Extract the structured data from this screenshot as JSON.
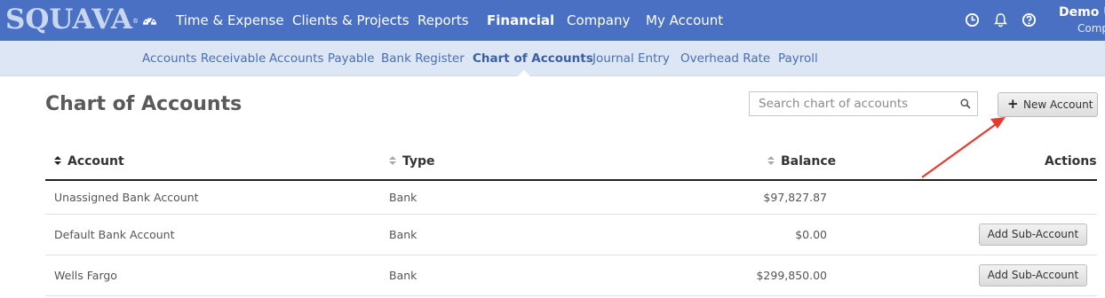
{
  "app": {
    "logo_text": "SQUAVA",
    "logo_mark": "®"
  },
  "nav": {
    "items": [
      {
        "label": "Time & Expense"
      },
      {
        "label": "Clients & Projects"
      },
      {
        "label": "Reports"
      },
      {
        "label": "Financial"
      },
      {
        "label": "Company"
      },
      {
        "label": "My Account"
      }
    ],
    "active": "Financial",
    "icons": [
      "dashboard-icon",
      "clock-icon",
      "bell-icon",
      "help-icon"
    ]
  },
  "user": {
    "name": "Demo U",
    "company": "Comp"
  },
  "subnav": {
    "items": [
      {
        "label": "Accounts Receivable"
      },
      {
        "label": "Accounts Payable"
      },
      {
        "label": "Bank Register"
      },
      {
        "label": "Chart of Accounts"
      },
      {
        "label": "Journal Entry"
      },
      {
        "label": "Overhead Rate"
      },
      {
        "label": "Payroll"
      }
    ],
    "active": "Chart of Accounts"
  },
  "page": {
    "title": "Chart of Accounts",
    "search_placeholder": "Search chart of accounts",
    "search_value": "",
    "new_button_label": "New Account"
  },
  "table": {
    "columns": [
      "Account",
      "Type",
      "Balance",
      "Actions"
    ],
    "rows": [
      {
        "account": "Unassigned Bank Account",
        "type": "Bank",
        "balance": "$97,827.87",
        "action": ""
      },
      {
        "account": "Default Bank Account",
        "type": "Bank",
        "balance": "$0.00",
        "action": "Add Sub-Account"
      },
      {
        "account": "Wells Fargo",
        "type": "Bank",
        "balance": "$299,850.00",
        "action": "Add Sub-Account"
      }
    ]
  },
  "colors": {
    "topbar": "#4a70c4",
    "subbar": "#dce6f5",
    "link": "#4a6fb5",
    "annotation_arrow": "#e8392f"
  }
}
